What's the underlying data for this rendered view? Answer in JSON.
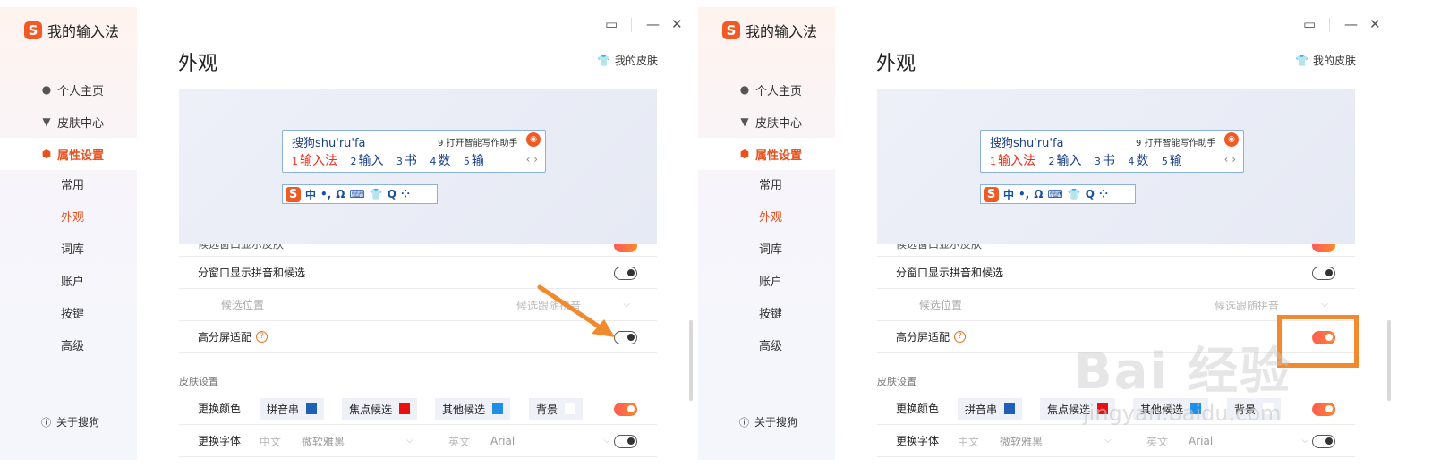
{
  "windows": [
    {
      "id": "left",
      "app_title": "我的输入法",
      "nav": [
        {
          "label": "个人主页",
          "icon": "user-icon"
        },
        {
          "label": "皮肤中心",
          "icon": "shirt-icon"
        },
        {
          "label": "属性设置",
          "icon": "gear-icon",
          "active": true
        }
      ],
      "subnav": [
        "常用",
        "外观",
        "词库",
        "账户",
        "按键",
        "高级"
      ],
      "active_sub": "外观",
      "about": "关于搜狗",
      "page_title": "外观",
      "my_skin": "我的皮肤",
      "preview": {
        "pinyin": "搜狗shu'ru'fa",
        "assist": "9 打开智能写作助手",
        "candidates": [
          {
            "n": "1",
            "w": "输入法"
          },
          {
            "n": "2",
            "w": "输入"
          },
          {
            "n": "3",
            "w": "书"
          },
          {
            "n": "4",
            "w": "数"
          },
          {
            "n": "5",
            "w": "输"
          }
        ],
        "status_bar": [
          "中",
          "•,",
          "Ω",
          "⌨",
          "👕",
          "Q",
          "⁘"
        ]
      },
      "rows": {
        "split_window": "分窗口显示拼音和候选",
        "cand_position": "候选位置",
        "cand_position_value": "候选跟随拼音",
        "high_dpi": "高分屏适配",
        "high_dpi_on": false,
        "skin_section": "皮肤设置",
        "change_color": "更换颜色",
        "chips": [
          {
            "label": "拼音串",
            "color": "#1f5fb8"
          },
          {
            "label": "焦点候选",
            "color": "#e81010"
          },
          {
            "label": "其他候选",
            "color": "#1f8fe8"
          },
          {
            "label": "背景",
            "color": "#ffffff"
          }
        ],
        "change_font": "更换字体",
        "font_cn_label": "中文",
        "font_cn": "微软雅黑",
        "font_en_label": "英文",
        "font_en": "Arial"
      }
    },
    {
      "id": "right",
      "app_title": "我的输入法",
      "nav": [
        {
          "label": "个人主页",
          "icon": "user-icon"
        },
        {
          "label": "皮肤中心",
          "icon": "shirt-icon"
        },
        {
          "label": "属性设置",
          "icon": "gear-icon",
          "active": true
        }
      ],
      "subnav": [
        "常用",
        "外观",
        "词库",
        "账户",
        "按键",
        "高级"
      ],
      "active_sub": "外观",
      "about": "关于搜狗",
      "page_title": "外观",
      "my_skin": "我的皮肤",
      "preview": {
        "pinyin": "搜狗shu'ru'fa",
        "assist": "9 打开智能写作助手",
        "candidates": [
          {
            "n": "1",
            "w": "输入法"
          },
          {
            "n": "2",
            "w": "输入"
          },
          {
            "n": "3",
            "w": "书"
          },
          {
            "n": "4",
            "w": "数"
          },
          {
            "n": "5",
            "w": "输"
          }
        ],
        "status_bar": [
          "中",
          "•,",
          "Ω",
          "⌨",
          "👕",
          "Q",
          "⁘"
        ]
      },
      "rows": {
        "split_window": "分窗口显示拼音和候选",
        "cand_position": "候选位置",
        "cand_position_value": "候选跟随拼音",
        "high_dpi": "高分屏适配",
        "high_dpi_on": true,
        "skin_section": "皮肤设置",
        "change_color": "更换颜色",
        "chips": [
          {
            "label": "拼音串",
            "color": "#1f5fb8"
          },
          {
            "label": "焦点候选",
            "color": "#e81010"
          },
          {
            "label": "其他候选",
            "color": "#1f8fe8"
          },
          {
            "label": "背景",
            "color": "#ffffff"
          }
        ],
        "change_font": "更换字体",
        "font_cn_label": "中文",
        "font_cn": "微软雅黑",
        "font_en_label": "英文",
        "font_en": "Arial"
      }
    }
  ],
  "watermark": {
    "text": "Bai 经验",
    "sub": "jingyan.baidu.com"
  },
  "accent": "#e8501c",
  "annotation_color": "#f08a2c"
}
